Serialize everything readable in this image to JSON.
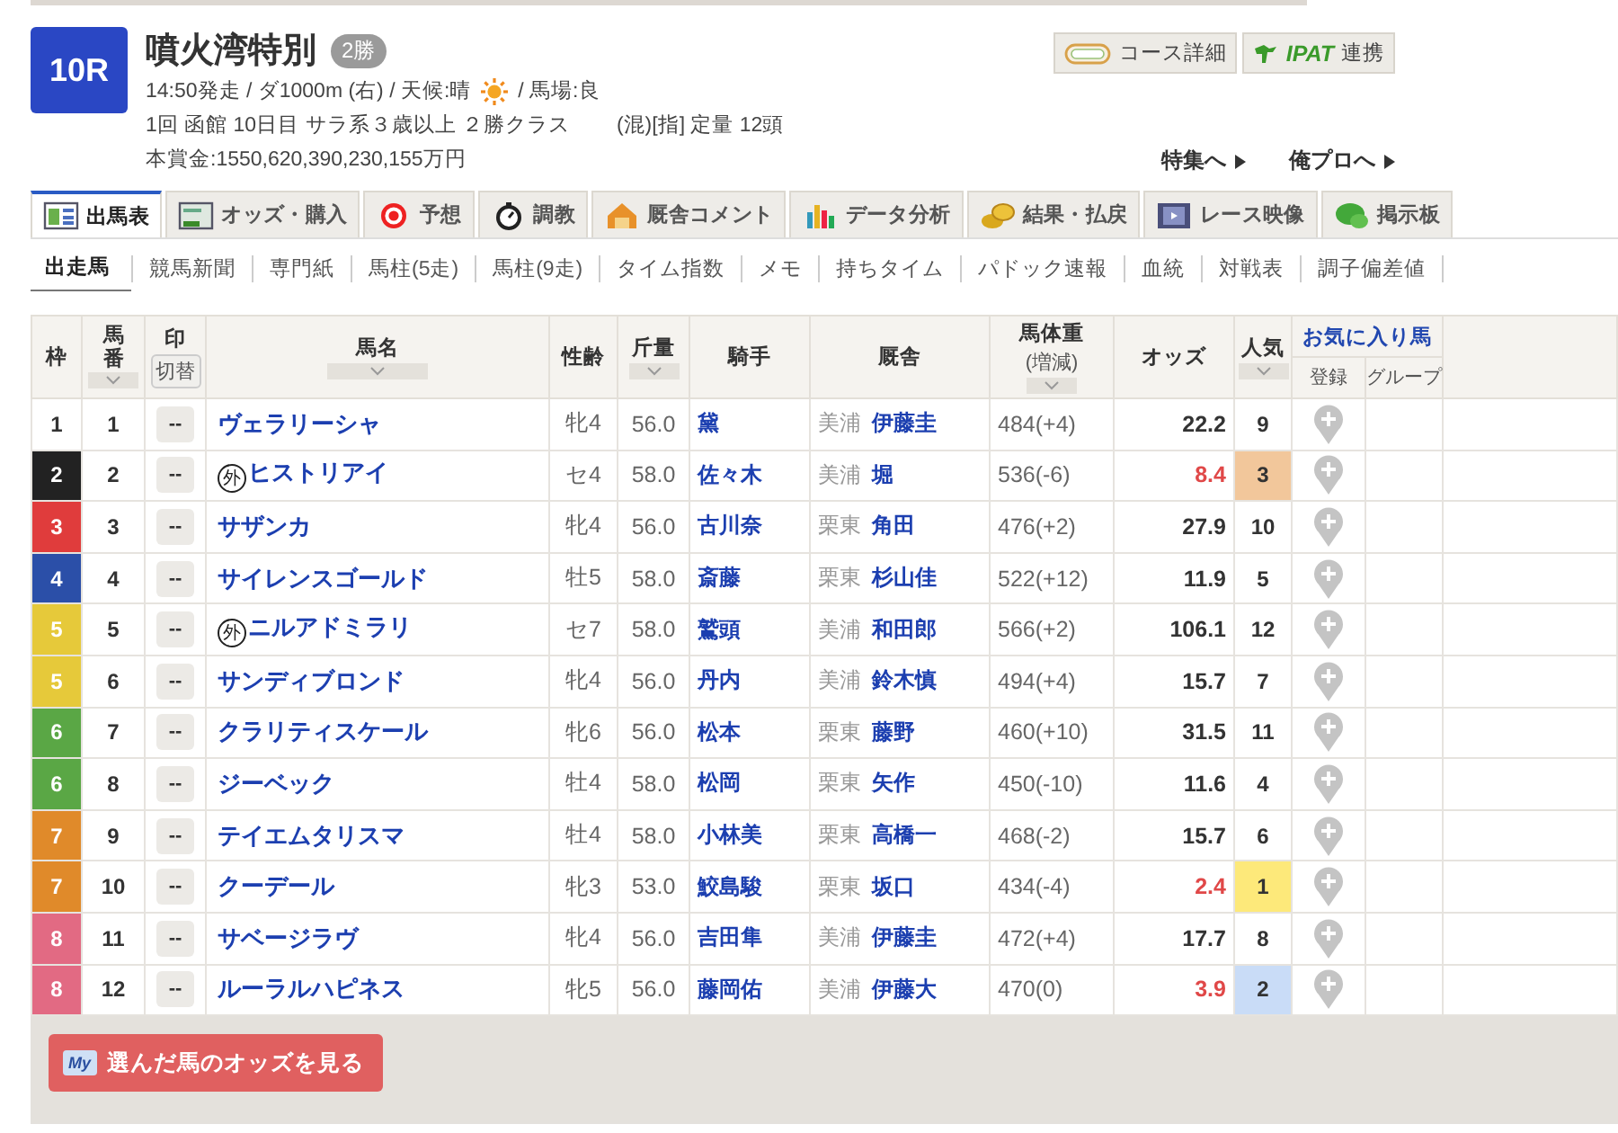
{
  "race": {
    "number": "10R",
    "name": "噴火湾特別",
    "grade": "2勝",
    "info_main": "14:50発走 / ダ1000m (右) / 天候:晴",
    "info_track": "/ 馬場:良",
    "schedule": "1回 函館 10日目 サラ系３歳以上 ２勝クラス",
    "conditions": "(混)[指] 定量 12頭",
    "prize": "本賞金:1550,620,390,230,155万円"
  },
  "header_buttons": [
    {
      "kind": "course",
      "label": "コース詳細"
    },
    {
      "kind": "ipat",
      "logo": "IPAT",
      "label": "連携"
    }
  ],
  "links": [
    "特集へ",
    "俺プロへ"
  ],
  "tabs": [
    {
      "kind": "table",
      "label": "出馬表",
      "selected": true
    },
    {
      "kind": "odds",
      "label": "オッズ・購入",
      "selected": false
    },
    {
      "kind": "target",
      "label": "予想",
      "selected": false
    },
    {
      "kind": "stopwatch",
      "label": "調教",
      "selected": false
    },
    {
      "kind": "barn",
      "label": "厩舎コメント",
      "selected": false
    },
    {
      "kind": "chart",
      "label": "データ分析",
      "selected": false
    },
    {
      "kind": "coins",
      "label": "結果・払戻",
      "selected": false
    },
    {
      "kind": "video",
      "label": "レース映像",
      "selected": false
    },
    {
      "kind": "chat",
      "label": "掲示板",
      "selected": false
    }
  ],
  "subnav": [
    {
      "label": "出走馬",
      "selected": true
    },
    {
      "label": "競馬新聞",
      "selected": false
    },
    {
      "label": "専門紙",
      "selected": false
    },
    {
      "label": "馬柱(5走)",
      "selected": false
    },
    {
      "label": "馬柱(9走)",
      "selected": false
    },
    {
      "label": "タイム指数",
      "selected": false
    },
    {
      "label": "メモ",
      "selected": false
    },
    {
      "label": "持ちタイム",
      "selected": false
    },
    {
      "label": "パドック速報",
      "selected": false
    },
    {
      "label": "血統",
      "selected": false
    },
    {
      "label": "対戦表",
      "selected": false
    },
    {
      "label": "調子偏差値",
      "selected": false
    }
  ],
  "table": {
    "headers": {
      "frame": "枠",
      "number": "馬番",
      "mark": "印",
      "mark_toggle": "切替",
      "name": "馬名",
      "sex_age": "性齢",
      "weight": "斤量",
      "jockey": "騎手",
      "trainer": "厩舎",
      "body_weight": "馬体重",
      "body_weight_sub": "(増減)",
      "odds": "オッズ",
      "popularity": "人気",
      "favorites": "お気に入り馬",
      "favorites_register": "登録",
      "favorites_group": "グループ"
    },
    "rows": [
      {
        "frame": "1",
        "color": "#ffffff",
        "number": "1",
        "mark": "--",
        "name": "ヴェラリーシャ",
        "sex_age": "牝4",
        "weight": "56.0",
        "jockey": "黛",
        "region": "美浦",
        "trainer": "伊藤圭",
        "body_weight": "484(+4)",
        "odds": "22.2",
        "odds_hot": false,
        "popularity": "9"
      },
      {
        "frame": "2",
        "color": "#222222",
        "number": "2",
        "mark": "--",
        "prefix": "外",
        "name": "ヒストリアイ",
        "sex_age": "セ4",
        "weight": "58.0",
        "jockey": "佐々木",
        "region": "美浦",
        "trainer": "堀",
        "body_weight": "536(-6)",
        "odds": "8.4",
        "odds_hot": true,
        "popularity": "3",
        "popularity_highlight": {
          "color": "#f2c79b"
        }
      },
      {
        "frame": "3",
        "color": "#e03c3c",
        "number": "3",
        "mark": "--",
        "name": "サザンカ",
        "sex_age": "牝4",
        "weight": "56.0",
        "jockey": "古川奈",
        "region": "栗東",
        "trainer": "角田",
        "body_weight": "476(+2)",
        "odds": "27.9",
        "odds_hot": false,
        "popularity": "10"
      },
      {
        "frame": "4",
        "color": "#2b4fa8",
        "number": "4",
        "mark": "--",
        "name": "サイレンスゴールド",
        "sex_age": "牡5",
        "weight": "58.0",
        "jockey": "斎藤",
        "region": "栗東",
        "trainer": "杉山佳",
        "body_weight": "522(+12)",
        "odds": "11.9",
        "odds_hot": false,
        "popularity": "5"
      },
      {
        "frame": "5",
        "color": "#e6c93a",
        "number": "5",
        "mark": "--",
        "prefix": "外",
        "name": "ニルアドミラリ",
        "sex_age": "セ7",
        "weight": "58.0",
        "jockey": "鷲頭",
        "region": "美浦",
        "trainer": "和田郎",
        "body_weight": "566(+2)",
        "odds": "106.1",
        "odds_hot": false,
        "popularity": "12"
      },
      {
        "frame": "5",
        "color": "#e6c93a",
        "number": "6",
        "mark": "--",
        "name": "サンディブロンド",
        "sex_age": "牝4",
        "weight": "56.0",
        "jockey": "丹内",
        "region": "美浦",
        "trainer": "鈴木慎",
        "body_weight": "494(+4)",
        "odds": "15.7",
        "odds_hot": false,
        "popularity": "7"
      },
      {
        "frame": "6",
        "color": "#5aa745",
        "number": "7",
        "mark": "--",
        "name": "クラリティスケール",
        "sex_age": "牝6",
        "weight": "56.0",
        "jockey": "松本",
        "region": "栗東",
        "trainer": "藤野",
        "body_weight": "460(+10)",
        "odds": "31.5",
        "odds_hot": false,
        "popularity": "11"
      },
      {
        "frame": "6",
        "color": "#5aa745",
        "number": "8",
        "mark": "--",
        "name": "ジーベック",
        "sex_age": "牡4",
        "weight": "58.0",
        "jockey": "松岡",
        "region": "栗東",
        "trainer": "矢作",
        "body_weight": "450(-10)",
        "odds": "11.6",
        "odds_hot": false,
        "popularity": "4"
      },
      {
        "frame": "7",
        "color": "#e08a2a",
        "number": "9",
        "mark": "--",
        "name": "テイエムタリスマ",
        "sex_age": "牡4",
        "weight": "58.0",
        "jockey": "小林美",
        "region": "栗東",
        "trainer": "高橋一",
        "body_weight": "468(-2)",
        "odds": "15.7",
        "odds_hot": false,
        "popularity": "6"
      },
      {
        "frame": "7",
        "color": "#e08a2a",
        "number": "10",
        "mark": "--",
        "name": "クーデール",
        "sex_age": "牝3",
        "weight": "53.0",
        "jockey": "鮫島駿",
        "region": "栗東",
        "trainer": "坂口",
        "body_weight": "434(-4)",
        "odds": "2.4",
        "odds_hot": true,
        "popularity": "1",
        "popularity_highlight": {
          "color": "#fde97a"
        }
      },
      {
        "frame": "8",
        "color": "#e26a83",
        "number": "11",
        "mark": "--",
        "name": "サベージラヴ",
        "sex_age": "牝4",
        "weight": "56.0",
        "jockey": "吉田隼",
        "region": "美浦",
        "trainer": "伊藤圭",
        "body_weight": "472(+4)",
        "odds": "17.7",
        "odds_hot": false,
        "popularity": "8"
      },
      {
        "frame": "8",
        "color": "#e26a83",
        "number": "12",
        "mark": "--",
        "name": "ルーラルハピネス",
        "sex_age": "牝5",
        "weight": "56.0",
        "jockey": "藤岡佑",
        "region": "美浦",
        "trainer": "伊藤大",
        "body_weight": "470(0)",
        "odds": "3.9",
        "odds_hot": true,
        "popularity": "2",
        "popularity_highlight": {
          "color": "#c9dcf7"
        }
      }
    ]
  },
  "footer_button": {
    "icon_text": "My",
    "label": "選んだ馬のオッズを見る"
  }
}
